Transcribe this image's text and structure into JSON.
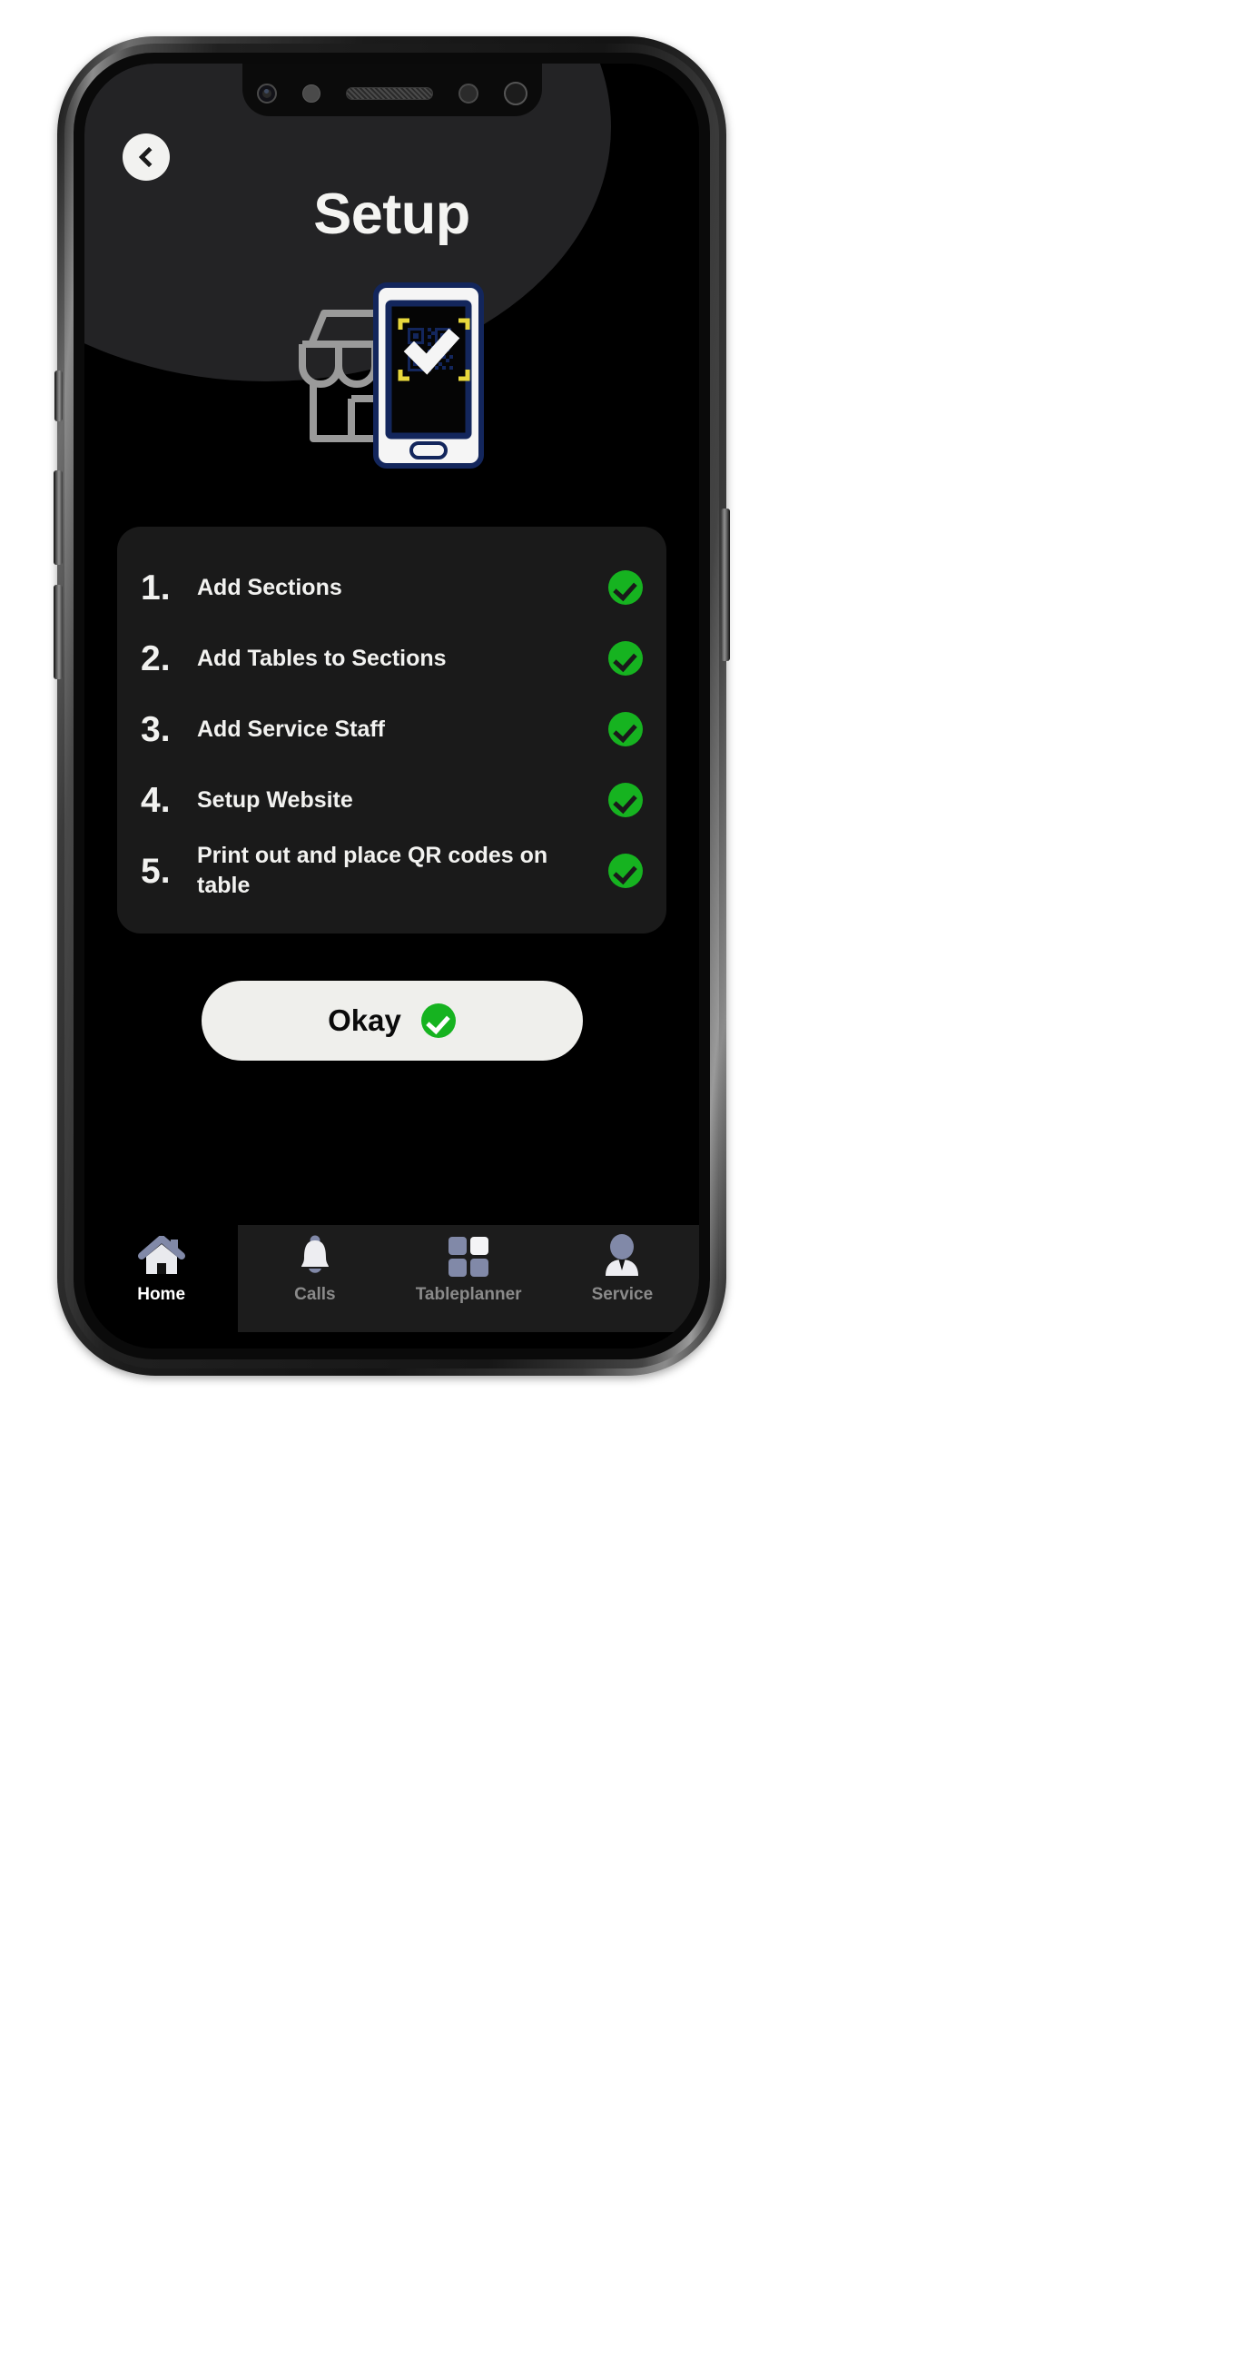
{
  "app": {
    "title": "Setup",
    "back_icon": "chevron-left-icon",
    "illustration": {
      "name": "store-qr-scan-illustration",
      "shop_icon": "storefront-icon",
      "phone_icon": "smartphone-qr-scan-icon",
      "qr_icon": "qr-code-icon",
      "check_icon": "check-icon",
      "colors": {
        "shop_gray": "#9a9a9a",
        "phone_navy": "#13265c",
        "phone_white": "#f5f5f5",
        "scan_bracket_yellow": "#e8d83c"
      }
    },
    "checklist": [
      {
        "number": "1.",
        "label": "Add Sections",
        "status_icon": "check-circle-icon",
        "done": true
      },
      {
        "number": "2.",
        "label": "Add Tables to Sections",
        "status_icon": "check-circle-icon",
        "done": true
      },
      {
        "number": "3.",
        "label": "Add Service Staff",
        "status_icon": "check-circle-icon",
        "done": true
      },
      {
        "number": "4.",
        "label": "Setup Website",
        "status_icon": "check-circle-icon",
        "done": true
      },
      {
        "number": "5.",
        "label": "Print out and place QR codes on table",
        "status_icon": "check-circle-icon",
        "done": true
      }
    ],
    "primary_button": {
      "label": "Okay",
      "icon": "check-circle-icon"
    },
    "bottom_nav": [
      {
        "label": "Home",
        "icon": "home-icon",
        "active": true
      },
      {
        "label": "Calls",
        "icon": "bell-icon",
        "active": false
      },
      {
        "label": "Tableplanner",
        "icon": "grid-squares-icon",
        "active": false
      },
      {
        "label": "Service",
        "icon": "person-icon",
        "active": false
      }
    ],
    "colors": {
      "background": "#000000",
      "card": "#1a1a1a",
      "hero_curve": "#232325",
      "accent_green": "#16b320",
      "text_primary": "#f2f2f0",
      "text_muted": "#8a8a8a",
      "button_bg": "#efefec",
      "nav_panel": "#1c1c1c"
    }
  }
}
